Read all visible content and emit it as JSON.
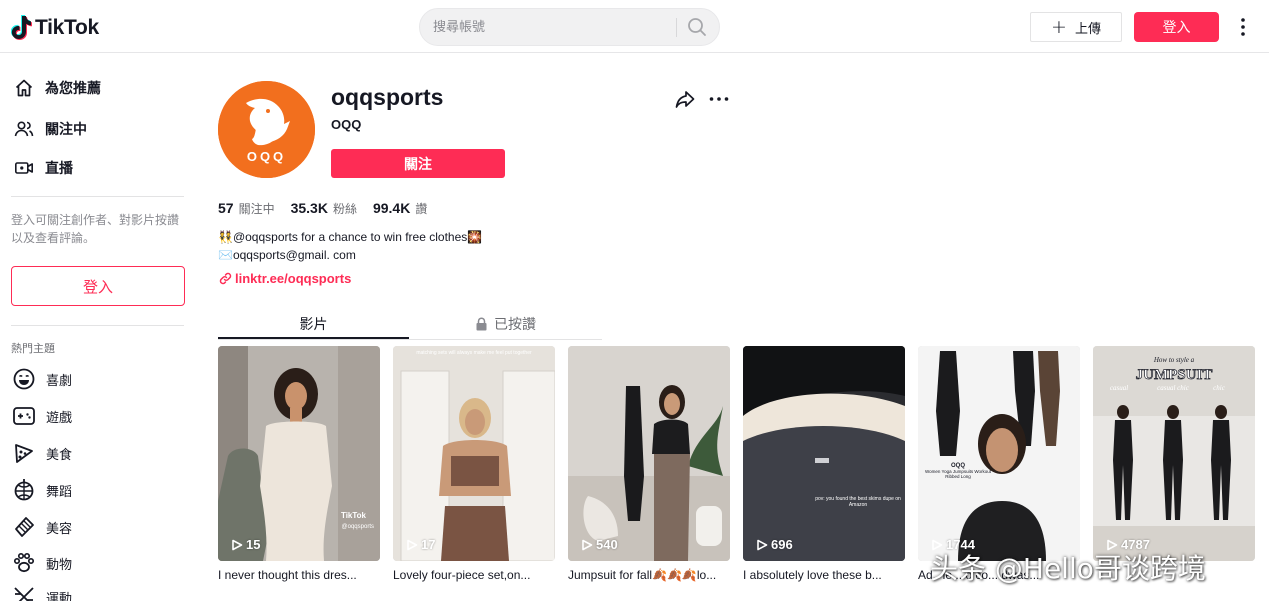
{
  "header": {
    "logo_text": "TikTok",
    "search_placeholder": "搜尋帳號",
    "upload_label": "上傳",
    "login_label": "登入"
  },
  "sidebar": {
    "nav": [
      {
        "label": "為您推薦",
        "icon": "home-icon"
      },
      {
        "label": "關注中",
        "icon": "following-icon"
      },
      {
        "label": "直播",
        "icon": "live-icon"
      }
    ],
    "hint": "登入可關注創作者、對影片按讚以及查看評論。",
    "login_label": "登入",
    "topics_title": "熱門主題",
    "topics": [
      {
        "label": "喜劇",
        "icon": "comedy-icon"
      },
      {
        "label": "遊戲",
        "icon": "gaming-icon"
      },
      {
        "label": "美食",
        "icon": "food-icon"
      },
      {
        "label": "舞蹈",
        "icon": "dance-icon"
      },
      {
        "label": "美容",
        "icon": "beauty-icon"
      },
      {
        "label": "動物",
        "icon": "animals-icon"
      },
      {
        "label": "運動",
        "icon": "sports-icon"
      }
    ]
  },
  "profile": {
    "username": "oqqsports",
    "nickname": "OQQ",
    "follow_label": "關注",
    "avatar_text": "OQQ",
    "stats": [
      {
        "value": "57",
        "label": "關注中"
      },
      {
        "value": "35.3K",
        "label": "粉絲"
      },
      {
        "value": "99.4K",
        "label": "讚"
      }
    ],
    "bio": [
      "👯@oqqsports for a chance to win free clothes🎇",
      "✉️oqqsports@gmail. com"
    ],
    "link": "linktr.ee/oqqsports"
  },
  "tabs": [
    {
      "label": "影片"
    },
    {
      "label": "已按讚"
    }
  ],
  "videos": [
    {
      "views": "15",
      "caption": "I never thought this dres..."
    },
    {
      "views": "17",
      "caption": "Lovely four-piece set,on..."
    },
    {
      "views": "540",
      "caption": "Jumpsuit for fall🍂🍂🍂lo..."
    },
    {
      "views": "696",
      "caption": "I absolutely love these b..."
    },
    {
      "views": "1744",
      "caption": "Ad.. ie... o co... dwas..."
    },
    {
      "views": "4787",
      "caption": ""
    }
  ],
  "overlay_texts": {
    "v1_tiktok": "TikTok",
    "v1_handle": "@oqqsports",
    "v2_top": "matching sets will always make me feel put together",
    "v4_top": "pov: you found the best skims dupe on Amazon",
    "v5_brand": "OQQ",
    "v5_desc": "Women Yoga Jumpsuits Workout Ribbed Long",
    "v6_top": "How to style a",
    "v6_title": "JUMPSUIT",
    "v6_labels": [
      "casual",
      "casual chic",
      "chic"
    ]
  },
  "watermark": "头条 @Hello哥谈跨境",
  "colors": {
    "brand": "#fe2c55",
    "avatar_bg": "#f26f1e",
    "text": "#161823",
    "muted": "#8a8b91"
  }
}
